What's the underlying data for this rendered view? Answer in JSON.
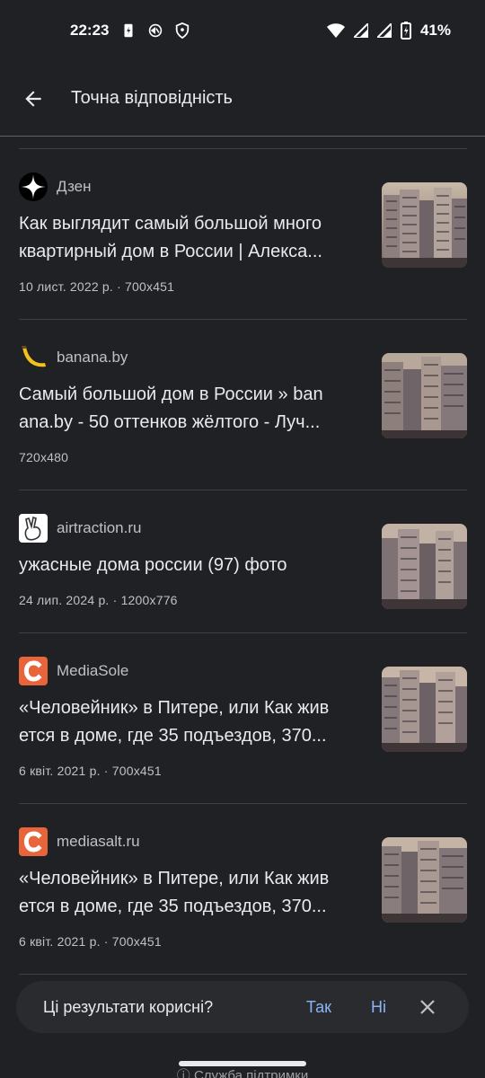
{
  "status": {
    "time": "22:23",
    "battery": "41%"
  },
  "appbar": {
    "title": "Точна відповідність"
  },
  "results": [
    {
      "source": "Дзен",
      "favicon": "dzen-star-icon",
      "title_l1": "Как выглядит самый большой много",
      "title_l2": "квартирный дом в России | Алекса...",
      "meta": "10 лист. 2022 р. · 700x451"
    },
    {
      "source": "banana.by",
      "favicon": "banana-icon",
      "title_l1": "Самый большой дом в России » ban",
      "title_l2": "ana.by - 50 оттенков жёлтого - Луч...",
      "meta": "720x480"
    },
    {
      "source": "airtraction.ru",
      "favicon": "victory-hand-icon",
      "title_l1": "ужасные дома россии (97) фото",
      "title_l2": "",
      "meta": "24 лип. 2024 р. · 1200x776"
    },
    {
      "source": "MediaSole",
      "favicon": "letter-c-icon",
      "title_l1": "«Человейник» в Питере, или Как жив",
      "title_l2": "ется в доме, где 35 подъездов, 370...",
      "meta": "6 квіт. 2021 р. · 700x451"
    },
    {
      "source": "mediasalt.ru",
      "favicon": "letter-c-icon",
      "title_l1": "«Человейник» в Питере, или Как жив",
      "title_l2": "ется в доме, где 35 подъездов, 370...",
      "meta": "6 квіт. 2021 р. · 700x451"
    }
  ],
  "feedback": {
    "question": "Ці результати корисні?",
    "yes": "Так",
    "no": "Ні"
  },
  "footer": {
    "help": "Служба підтримки"
  },
  "colors": {
    "background": "#202124",
    "accent": "#8ab4f8",
    "c_logo": "#e8643a"
  }
}
